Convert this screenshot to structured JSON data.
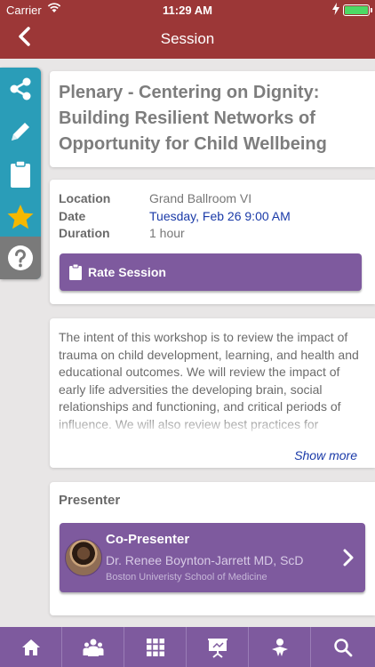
{
  "status_bar": {
    "carrier": "Carrier",
    "time": "11:29 AM"
  },
  "nav": {
    "title": "Session"
  },
  "rail_icons": [
    "share-icon",
    "pencil-icon",
    "clipboard-icon",
    "star-icon",
    "help-icon"
  ],
  "session": {
    "title": "Plenary - Centering on Dignity: Building Resilient Networks of Opportunity for Child Wellbeing",
    "location_label": "Location",
    "location": "Grand Ballroom VI",
    "date_label": "Date",
    "date": "Tuesday, Feb 26 9:00 AM",
    "duration_label": "Duration",
    "duration": "1 hour",
    "rate_button": "Rate Session"
  },
  "description": {
    "text": "The intent of this workshop is to review the impact of trauma on child development, learning, and health and educational outcomes. We will review the impact of early life adversities the developing brain, social relationships and functioning, and critical periods of influence. We will also review best practices for strengthening school-wide supports and connecting to community resources.",
    "show_more": "Show more"
  },
  "presenter": {
    "heading": "Presenter",
    "role": "Co-Presenter",
    "name": "Dr. Renee Boynton-Jarrett MD, ScD",
    "org": "Boston Univeristy School of Medicine"
  },
  "tabs": [
    "home-icon",
    "people-icon",
    "grid-icon",
    "presentation-icon",
    "sponsor-icon",
    "search-icon"
  ],
  "colors": {
    "nav_bar": "#9c3737",
    "accent_purple": "#7e5a9e",
    "rail_teal": "#2a9db8",
    "star_gold": "#f5b800",
    "link_blue": "#1a3aa8"
  }
}
